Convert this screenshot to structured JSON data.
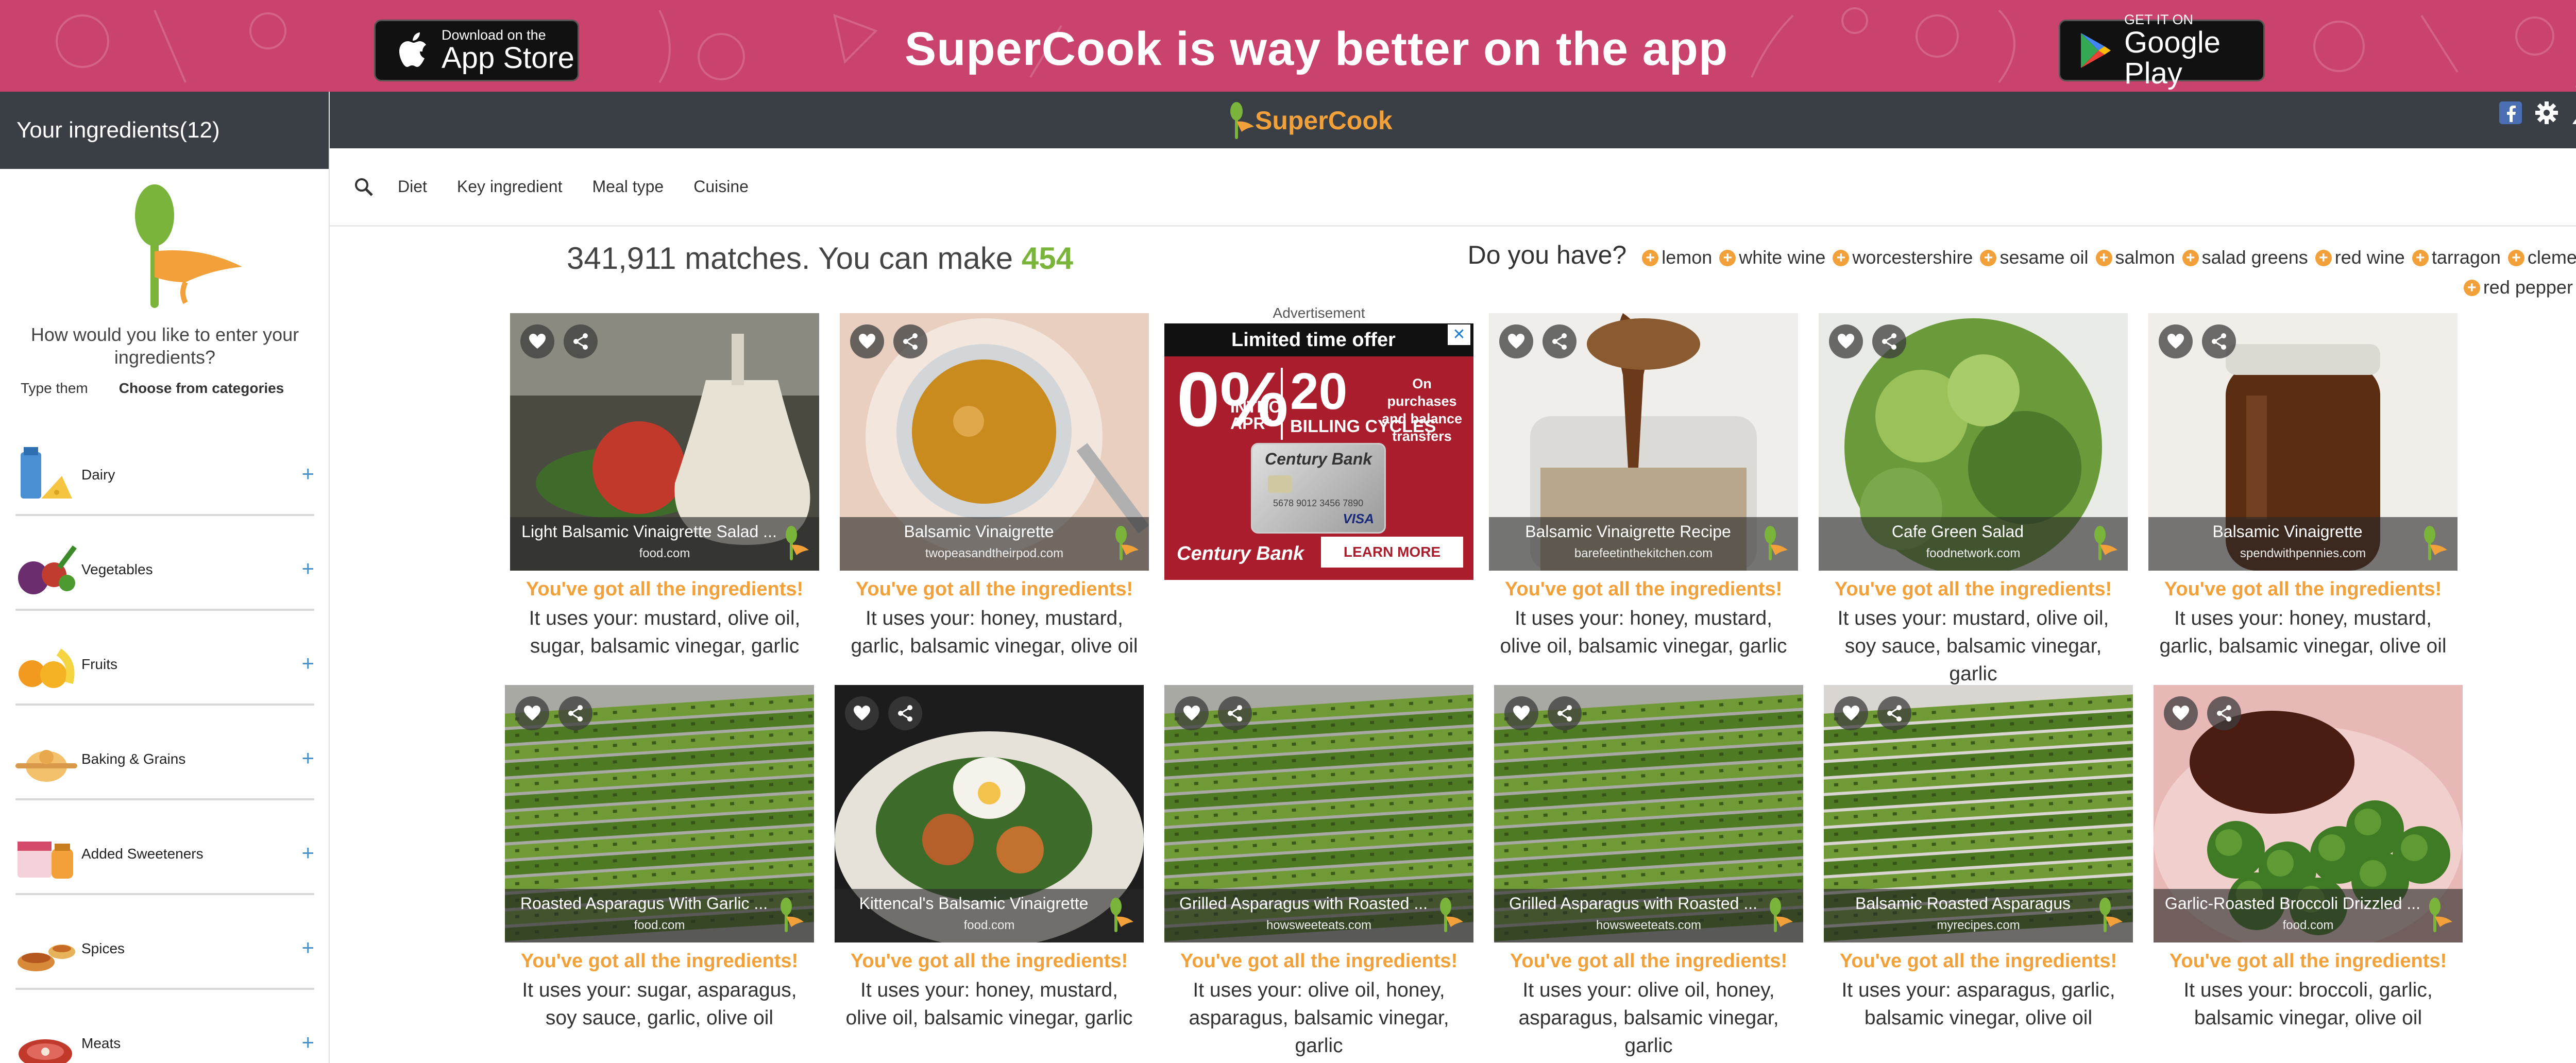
{
  "banner": {
    "headline": "SuperCook is way better on the app",
    "appstore": {
      "small": "Download on the",
      "big": "App Store"
    },
    "googleplay": {
      "small": "GET IT ON",
      "big": "Google Play"
    }
  },
  "sidebar": {
    "header": "Your ingredients(12)",
    "prompt": "How would you like to enter your ingredients?",
    "tabs": [
      "Type them",
      "Choose from categories"
    ],
    "categories": [
      "Dairy",
      "Vegetables",
      "Fruits",
      "Baking & Grains",
      "Added Sweeteners",
      "Spices",
      "Meats"
    ]
  },
  "logo": {
    "text": "SuperCook"
  },
  "top_icons": [
    "facebook-icon",
    "gear-icon",
    "user-icon",
    "help-icon"
  ],
  "filters": [
    "Diet",
    "Key ingredient",
    "Meal type",
    "Cuisine"
  ],
  "matches": {
    "prefix": "341,911 matches. You can make",
    "count": "454"
  },
  "do_you_have": {
    "label": "Do you have?",
    "items": [
      "lemon",
      "white wine",
      "worcestershire",
      "sesame oil",
      "salmon",
      "salad greens",
      "red wine",
      "tarragon",
      "clementine",
      "red pepper flake"
    ]
  },
  "advertisement": {
    "label": "Advertisement",
    "headline": "Limited time offer",
    "rate": "0%",
    "intro": "INTRO APR*",
    "cycles_num": "20",
    "cycles_lbl": "BILLING CYCLES",
    "purchases": "On purchases and balance transfers",
    "card_name": "Century Bank",
    "card_number": "5678 9012 3456 7890",
    "card_network": "VISA",
    "brand": "Century Bank",
    "cta": "LEARN MORE",
    "close": "✕"
  },
  "have_all": "You've got all the ingredients!",
  "recipes": [
    {
      "title": "Light Balsamic Vinaigrette Salad ...",
      "source": "food.com",
      "uses": "It uses your: mustard, olive oil, sugar, balsamic vinegar, garlic"
    },
    {
      "title": "Balsamic Vinaigrette",
      "source": "twopeasandtheirpod.com",
      "uses": "It uses your: honey, mustard, garlic, balsamic vinegar, olive oil"
    },
    {
      "title": "Balsamic Vinaigrette Recipe",
      "source": "barefeetinthekitchen.com",
      "uses": "It uses your: honey, mustard, olive oil, balsamic vinegar, garlic"
    },
    {
      "title": "Cafe Green Salad",
      "source": "foodnetwork.com",
      "uses": "It uses your: mustard, olive oil, soy sauce, balsamic vinegar, garlic"
    },
    {
      "title": "Balsamic Vinaigrette",
      "source": "spendwithpennies.com",
      "uses": "It uses your: honey, mustard, garlic, balsamic vinegar, olive oil"
    },
    {
      "title": "Roasted Asparagus With Garlic ...",
      "source": "food.com",
      "uses": "It uses your: sugar, asparagus, soy sauce, garlic, olive oil"
    },
    {
      "title": "Kittencal's Balsamic Vinaigrette",
      "source": "food.com",
      "uses": "It uses your: honey, mustard, olive oil, balsamic vinegar, garlic"
    },
    {
      "title": "Grilled Asparagus with Roasted ...",
      "source": "howsweeteats.com",
      "uses": "It uses your: olive oil, honey, asparagus, balsamic vinegar, garlic"
    },
    {
      "title": "Grilled Asparagus with Roasted ...",
      "source": "howsweeteats.com",
      "uses": "It uses your: olive oil, honey, asparagus, balsamic vinegar, garlic"
    },
    {
      "title": "Balsamic Roasted Asparagus",
      "source": "myrecipes.com",
      "uses": "It uses your: asparagus, garlic, balsamic vinegar, olive oil"
    },
    {
      "title": "Garlic-Roasted Broccoli Drizzled ...",
      "source": "food.com",
      "uses": "It uses your: broccoli, garlic, balsamic vinegar, olive oil"
    }
  ],
  "colors": {
    "banner": "#c9436c",
    "dark": "#3a3f45",
    "accent_orange": "#f2a13a",
    "accent_green": "#7ab43a"
  }
}
